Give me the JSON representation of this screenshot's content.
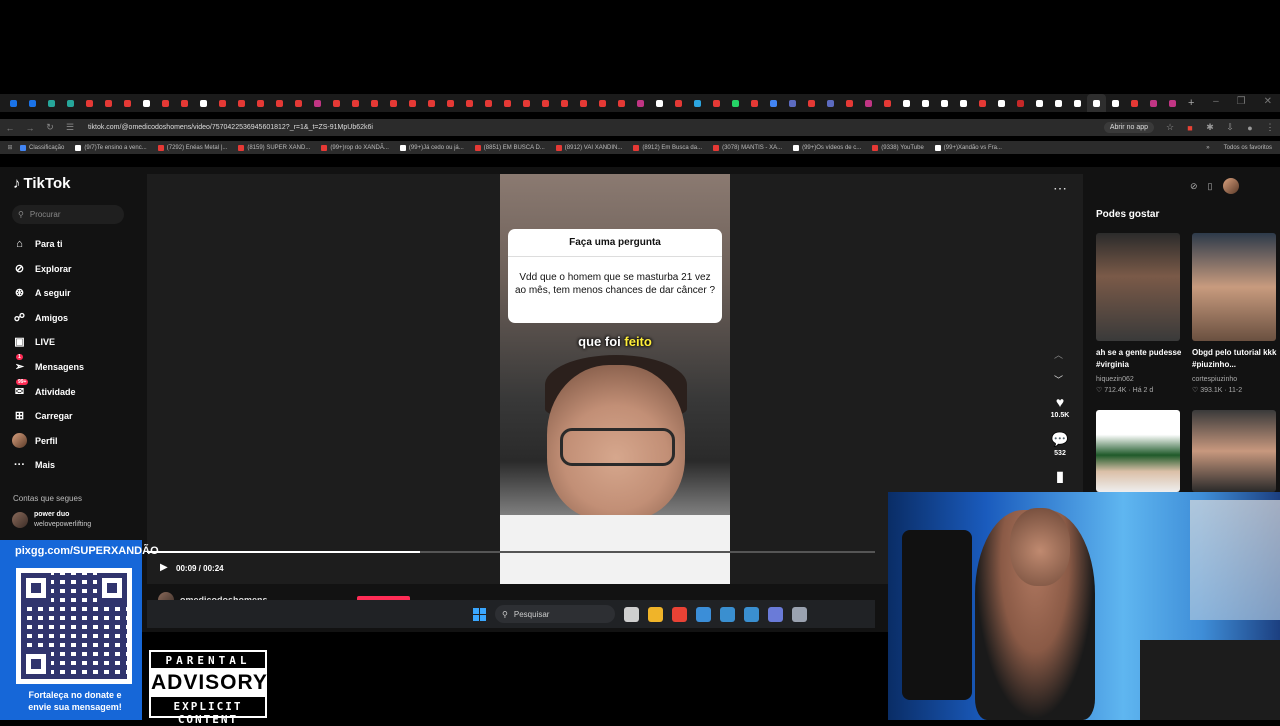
{
  "browser": {
    "tab_colors": [
      "#1a73e8",
      "#1a73e8",
      "#26a69a",
      "#26a69a",
      "#e53935",
      "#e53935",
      "#e53935",
      "#ffffff",
      "#e53935",
      "#e53935",
      "#ffffff",
      "#e53935",
      "#e53935",
      "#e53935",
      "#e53935",
      "#e53935",
      "#c13584",
      "#e53935",
      "#e53935",
      "#e53935",
      "#e53935",
      "#e53935",
      "#e53935",
      "#e53935",
      "#e53935",
      "#e53935",
      "#e53935",
      "#e53935",
      "#e53935",
      "#e53935",
      "#e53935",
      "#e53935",
      "#e53935",
      "#c13584",
      "#ffffff",
      "#e53935",
      "#2ca5e0",
      "#e53935",
      "#25d366",
      "#e53935",
      "#4285f4",
      "#5c6bc0",
      "#e53935",
      "#5c6bc0",
      "#e53935",
      "#c13584",
      "#e53935",
      "#ffffff",
      "#ffffff",
      "#ffffff",
      "#ffffff",
      "#e53935",
      "#ffffff",
      "#c62828",
      "#ffffff",
      "#ffffff",
      "#ffffff",
      "#ffffff",
      "#ffffff",
      "#e53935",
      "#c13584",
      "#c13584"
    ],
    "new_tab": "+",
    "url": "tiktok.com/@omedicodoshomens/video/7570422536945601812?_r=1&_t=ZS-91MpUb62k6i",
    "open_app": "Abrir no app",
    "bookmarks": [
      {
        "label": "Classificação",
        "color": "#4285f4"
      },
      {
        "label": "(9/7)Te ensino a venc...",
        "color": "#ffffff"
      },
      {
        "label": "(7292) Enéas Metal |...",
        "color": "#e53935"
      },
      {
        "label": "(8159) SUPER XAND...",
        "color": "#e53935"
      },
      {
        "label": "(99+)rop do XANDÃ...",
        "color": "#e53935"
      },
      {
        "label": "(99+)Já cedo ou já...",
        "color": "#ffffff"
      },
      {
        "label": "(8851) EM BUSCA D...",
        "color": "#e53935"
      },
      {
        "label": "(8912) VAI XANDIN...",
        "color": "#e53935"
      },
      {
        "label": "(8912) Em Busca da...",
        "color": "#e53935"
      },
      {
        "label": "(3078) MANTIS - XA...",
        "color": "#e53935"
      },
      {
        "label": "(99+)Os vídeos de c...",
        "color": "#ffffff"
      },
      {
        "label": "(9338) YouTube",
        "color": "#e53935"
      },
      {
        "label": "(99+)Xandão vs Fra...",
        "color": "#ffffff"
      }
    ],
    "all_bookmarks": "Todos os favoritos"
  },
  "tiktok": {
    "logo": "TikTok",
    "search_placeholder": "Procurar",
    "nav": [
      {
        "label": "Para ti",
        "icon": "home-icon",
        "glyph": "⌂"
      },
      {
        "label": "Explorar",
        "icon": "compass-icon",
        "glyph": "⊘"
      },
      {
        "label": "A seguir",
        "icon": "following-icon",
        "glyph": "⊛"
      },
      {
        "label": "Amigos",
        "icon": "friends-icon",
        "glyph": "☍"
      },
      {
        "label": "LIVE",
        "icon": "live-icon",
        "glyph": "▣"
      },
      {
        "label": "Mensagens",
        "icon": "messages-icon",
        "glyph": "➢",
        "badge": "1"
      },
      {
        "label": "Atividade",
        "icon": "activity-icon",
        "glyph": "✉",
        "badge": "99+"
      },
      {
        "label": "Carregar",
        "icon": "upload-icon",
        "glyph": "⊞"
      },
      {
        "label": "Perfil",
        "icon": "profile-avatar-icon",
        "glyph": "●"
      },
      {
        "label": "Mais",
        "icon": "more-icon",
        "glyph": "···"
      }
    ],
    "following_title": "Contas que segues",
    "following": [
      {
        "name": "power duo",
        "handle": "welovepowerlifting"
      }
    ],
    "video": {
      "question_title": "Faça uma pergunta",
      "question_text": "Vdd que o homem que se masturba 21 vez ao mês,  tem menos chances de dar câncer ?",
      "caption_plain": "que foi",
      "caption_highlight": "feito",
      "time": "00:09 / 00:24",
      "progress": 0.375,
      "likes": "10.5K",
      "comments": "532",
      "creator": "omedicodoshomens"
    },
    "suggestions_title": "Podes gostar",
    "suggestions": [
      {
        "caption": "ah se a gente pudesse #virginia",
        "author": "hiquezin062",
        "views": "712.4K",
        "age": "Há 2 d"
      },
      {
        "caption": "Obgd pelo tutorial kkk #piuzinho...",
        "author": "cortespiuzinho",
        "views": "393.1K",
        "age": "11-2"
      },
      {
        "caption": "",
        "author": "",
        "views": "",
        "age": ""
      },
      {
        "caption": "",
        "author": "",
        "views": "",
        "age": ""
      }
    ]
  },
  "taskbar": {
    "search": "Pesquisar",
    "app_colors": [
      "#cfcfcf",
      "#f0b429",
      "#e94235",
      "#3b8ed8",
      "#3a8fd0",
      "#3a8fd0",
      "#6a7bd8",
      "#9aa2b0"
    ]
  },
  "overlay": {
    "pix_url": "pixgg.com/SUPERXANDÃO",
    "pix_message_line1": "Fortaleça no donate e",
    "pix_message_line2": "envie sua mensagem!",
    "advisory_line1": "PARENTAL",
    "advisory_line2": "ADVISORY",
    "advisory_line3": "EXPLICIT CONTENT"
  }
}
